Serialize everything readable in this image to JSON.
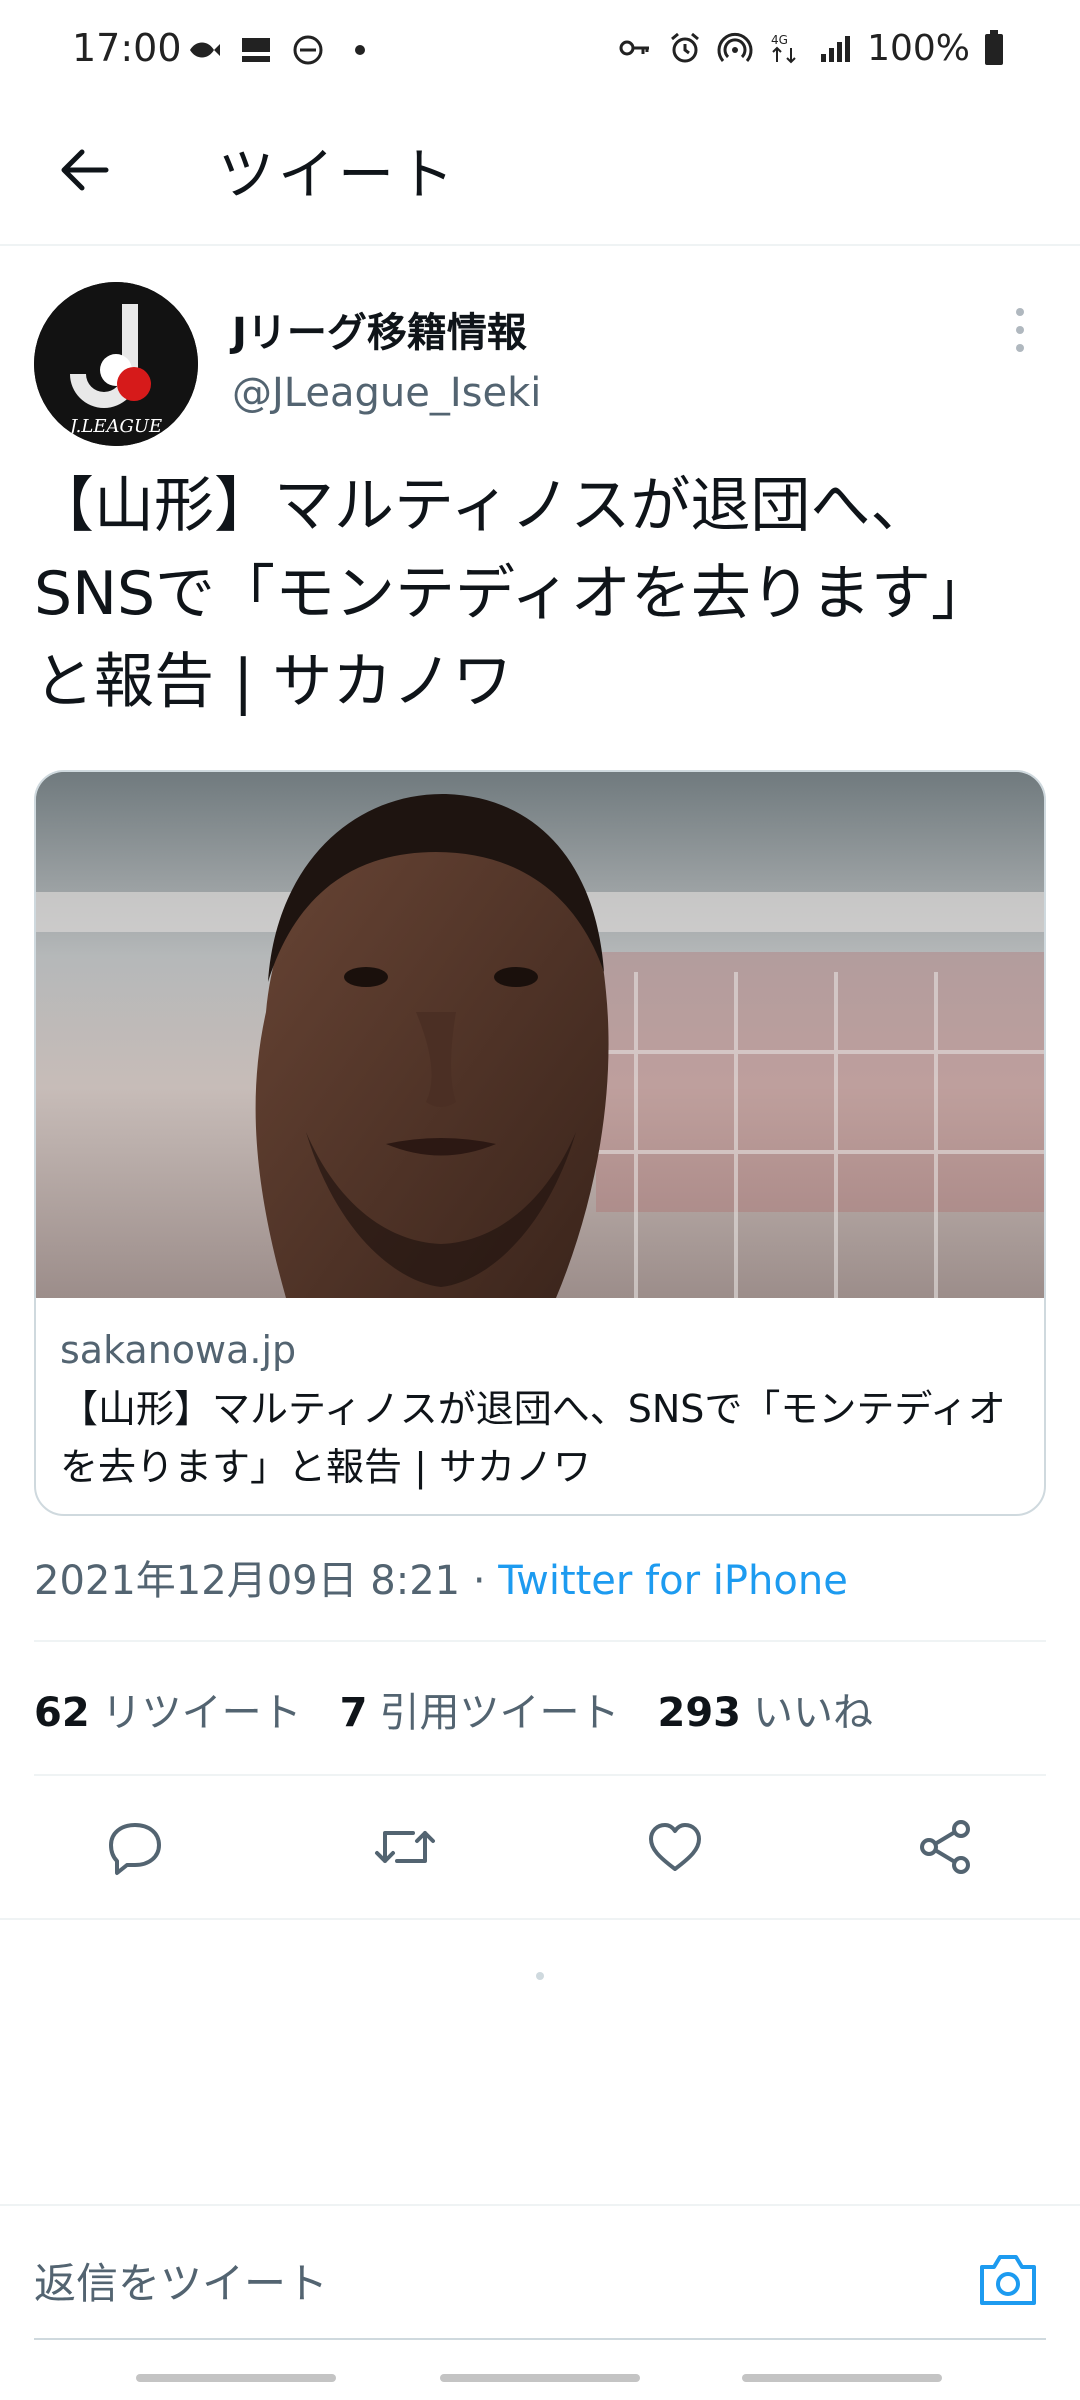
{
  "status_bar": {
    "time": "17:00",
    "battery_text": "100%",
    "left_icons": [
      "fish-icon",
      "kura-icon",
      "dnd-icon",
      "dot-icon"
    ],
    "right_icons": [
      "key-icon",
      "alarm-icon",
      "hotspot-icon",
      "network-4g-icon",
      "signal-icon",
      "battery-icon"
    ]
  },
  "header": {
    "title": "ツイート",
    "back_icon": "arrow-left-icon"
  },
  "tweet": {
    "author_name": "Jリーグ移籍情報",
    "author_handle": "@JLeague_Iseki",
    "avatar_label": "J.LEAGUE",
    "text": "【山形】マルティノスが退団へ、SNSで「モンテディオを去ります」と報告 | サカノワ",
    "card": {
      "domain": "sakanowa.jp",
      "title": "【山形】マルティノスが退団へ、SNSで「モンテディオを去ります」と報告 | サカノワ"
    },
    "timestamp": "2021年12月09日 8:21",
    "separator": " · ",
    "source": "Twitter for iPhone",
    "stats": [
      {
        "count": "62",
        "label": "リツイート"
      },
      {
        "count": "7",
        "label": "引用ツイート"
      },
      {
        "count": "293",
        "label": "いいね"
      }
    ],
    "actions": [
      "reply-icon",
      "retweet-icon",
      "like-icon",
      "share-icon"
    ]
  },
  "reply": {
    "placeholder": "返信をツイート"
  },
  "colors": {
    "accent": "#1d9bf0",
    "text_primary": "#0f1419",
    "text_secondary": "#536471",
    "border": "#cfd9de"
  }
}
